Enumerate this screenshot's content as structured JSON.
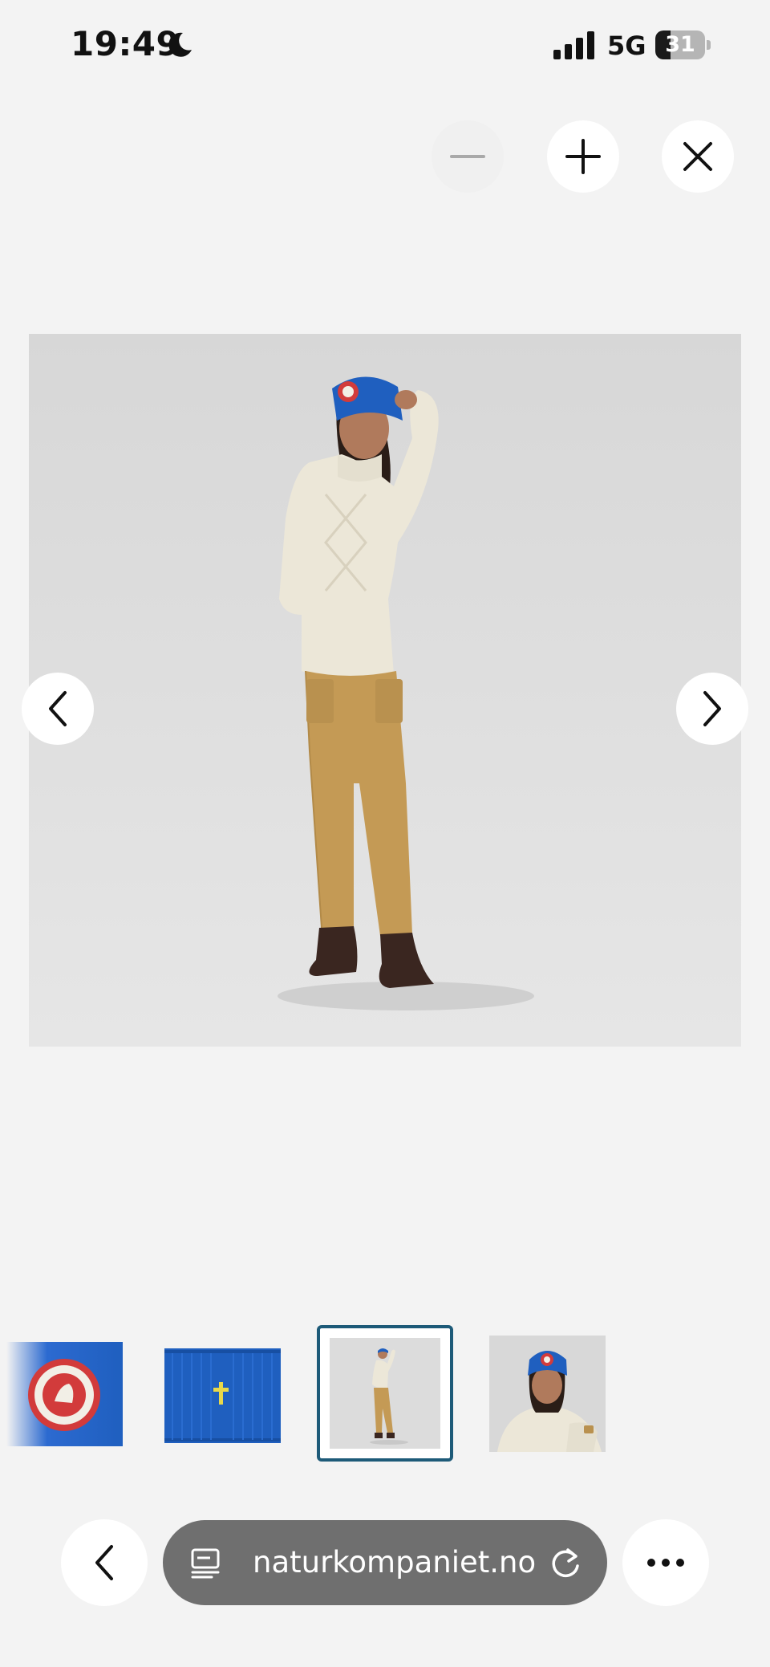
{
  "status_bar": {
    "time": "19:49",
    "network": "5G",
    "battery": "31",
    "battery_level": 0.31,
    "moon_icon": "moon-icon",
    "signal_icon": "cellular-signal-icon"
  },
  "viewer": {
    "controls": {
      "zoom_out_icon": "minus-icon",
      "zoom_out_enabled": false,
      "zoom_in_icon": "plus-icon",
      "close_icon": "close-icon"
    },
    "main_image": {
      "subject": "model-wearing-blue-headband"
    },
    "prev_icon": "chevron-left-icon",
    "next_icon": "chevron-right-icon",
    "thumbnails": [
      {
        "subject": "headband-logo-closeup",
        "selected": false
      },
      {
        "subject": "headband-back-closeup",
        "selected": false
      },
      {
        "subject": "model-full-body",
        "selected": true
      },
      {
        "subject": "model-portrait",
        "selected": false
      }
    ]
  },
  "browser": {
    "back_icon": "chevron-left-icon",
    "reader_icon": "reader-mode-icon",
    "url": "naturkompaniet.no",
    "reload_icon": "reload-icon",
    "more_icon": "more-horizontal-icon"
  },
  "colors": {
    "background": "#f3f3f3",
    "headband_blue": "#1f5fbf",
    "selected_thumb_border": "#1d5a78",
    "address_bar": "#6f6f6f"
  }
}
